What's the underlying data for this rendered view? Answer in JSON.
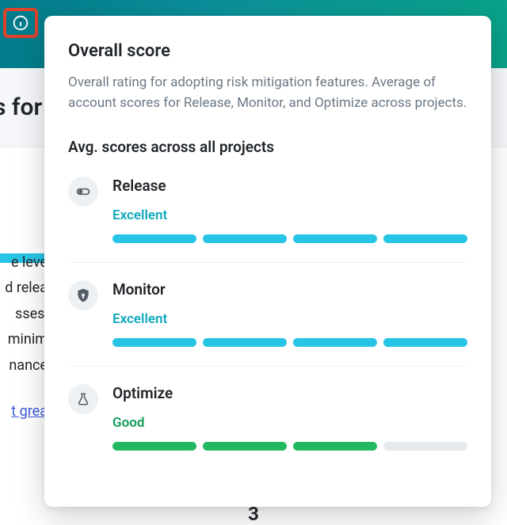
{
  "background": {
    "header_fragment": "s for",
    "line1": "e leve",
    "line2": "d relea",
    "line3": "sses,",
    "line4": "minim",
    "line5": "nance",
    "link_fragment": "t grea",
    "footer_number": "3"
  },
  "popover": {
    "title": "Overall score",
    "description": "Overall rating for adopting risk mitigation features. Average of account scores for Release, Monitor, and Optimize across projects.",
    "subtitle": "Avg. scores across all projects",
    "metrics": [
      {
        "name": "Release",
        "rating": "Excellent",
        "rating_class": "rating-excellent",
        "filled": 4,
        "total": 4,
        "fill_color": "cyan",
        "icon": "toggle-icon"
      },
      {
        "name": "Monitor",
        "rating": "Excellent",
        "rating_class": "rating-excellent",
        "filled": 4,
        "total": 4,
        "fill_color": "cyan",
        "icon": "shield-icon"
      },
      {
        "name": "Optimize",
        "rating": "Good",
        "rating_class": "rating-good",
        "filled": 3,
        "total": 4,
        "fill_color": "green",
        "icon": "beaker-icon"
      }
    ]
  }
}
